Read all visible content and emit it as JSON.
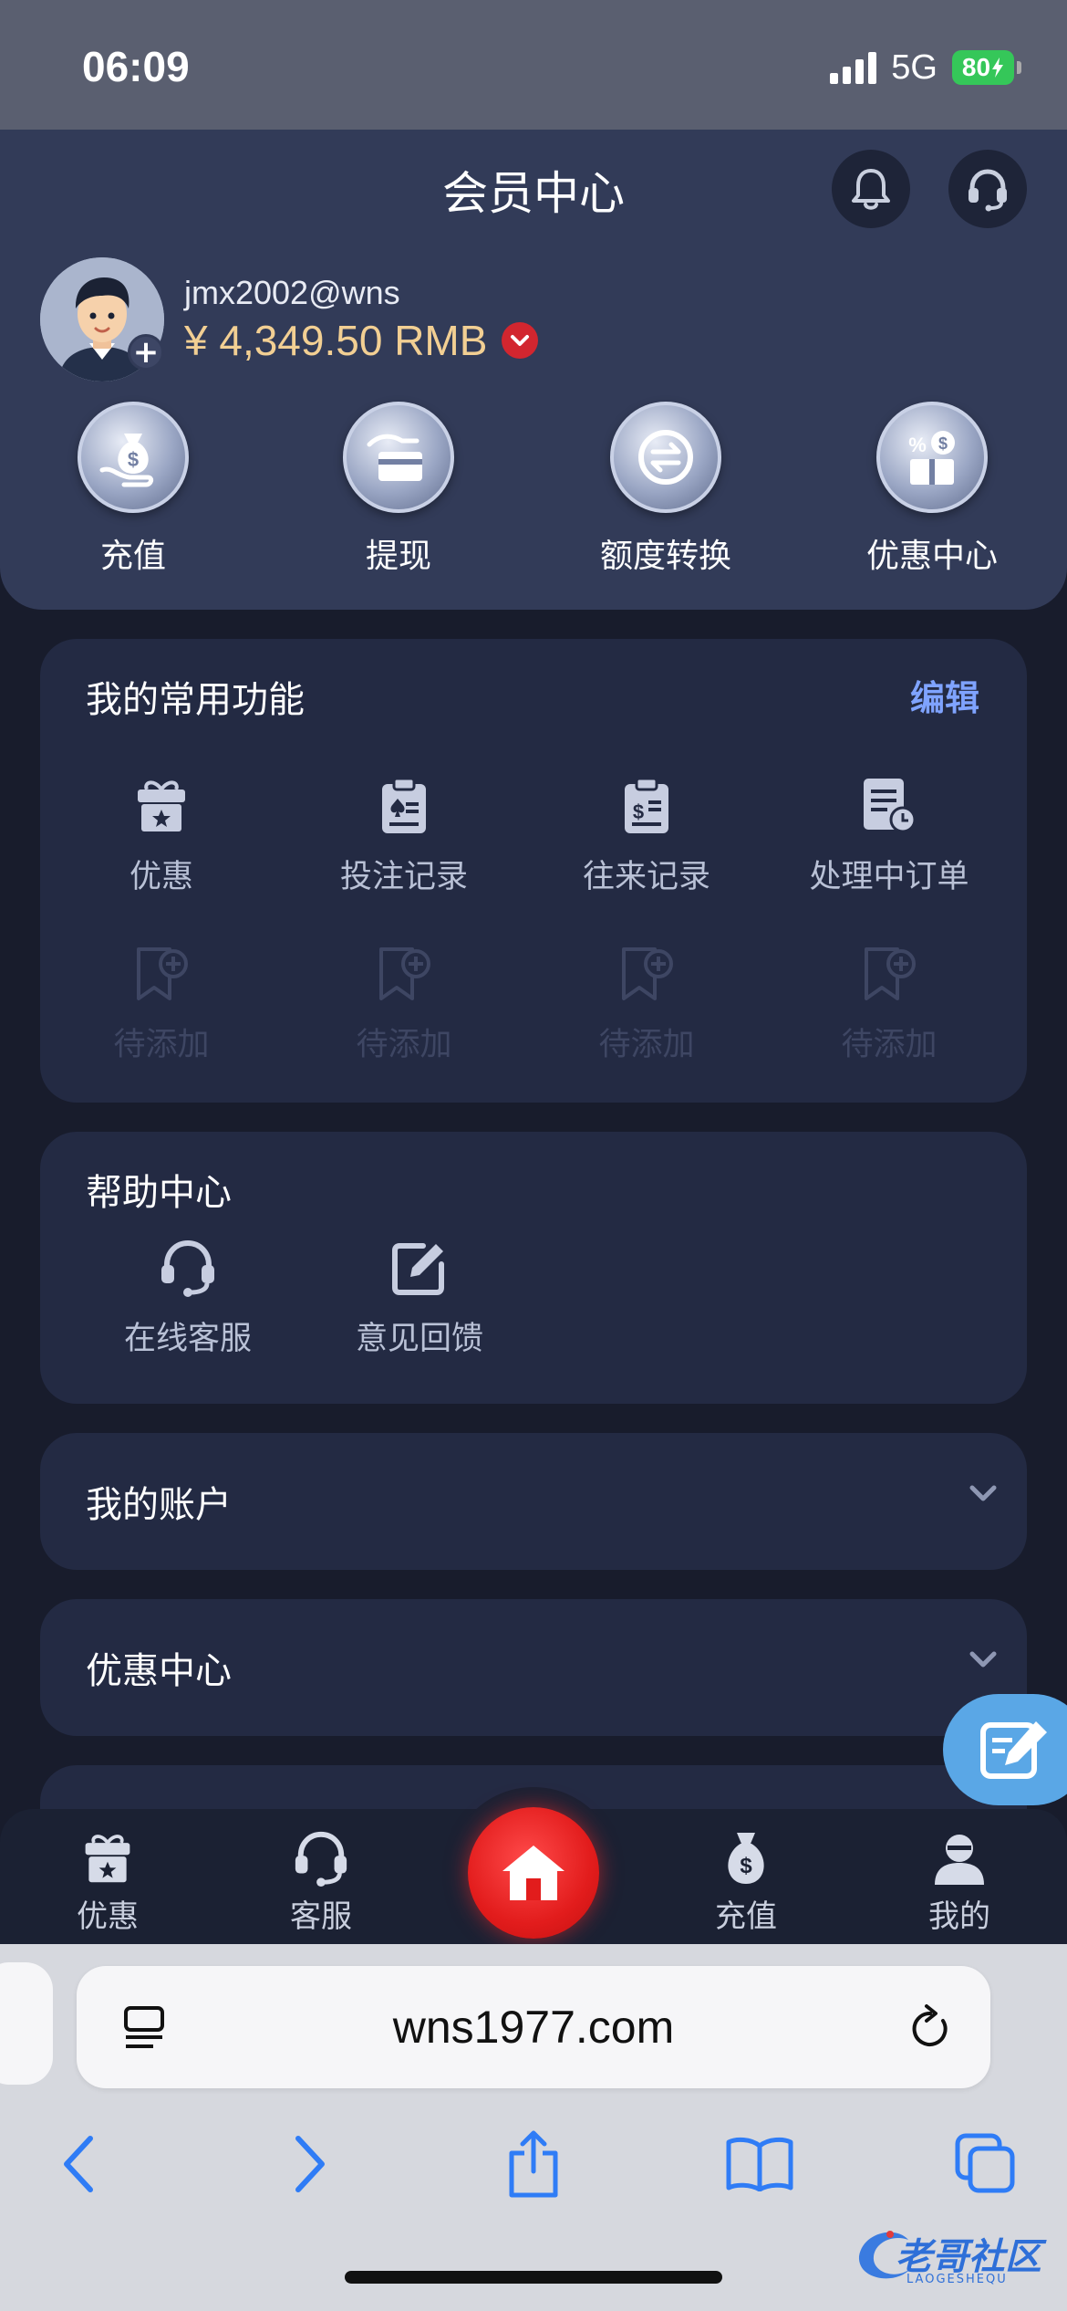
{
  "status_bar": {
    "time": "06:09",
    "network": "5G",
    "battery": "80"
  },
  "header": {
    "title": "会员中心",
    "username": "jmx2002@wns",
    "balance": "¥ 4,349.50 RMB",
    "quick_actions": [
      {
        "label": "充值",
        "icon": "money-bag-hand-icon"
      },
      {
        "label": "提现",
        "icon": "withdraw-card-icon"
      },
      {
        "label": "额度转换",
        "icon": "exchange-icon"
      },
      {
        "label": "优惠中心",
        "icon": "promo-center-icon"
      }
    ]
  },
  "frequent": {
    "title": "我的常用功能",
    "edit_label": "编辑",
    "items": [
      {
        "label": "优惠",
        "icon": "gift-icon"
      },
      {
        "label": "投注记录",
        "icon": "bet-record-icon"
      },
      {
        "label": "往来记录",
        "icon": "transaction-record-icon"
      },
      {
        "label": "处理中订单",
        "icon": "pending-order-icon"
      }
    ],
    "placeholders": [
      "待添加",
      "待添加",
      "待添加",
      "待添加"
    ]
  },
  "help": {
    "title": "帮助中心",
    "items": [
      {
        "label": "在线客服",
        "icon": "headset-icon"
      },
      {
        "label": "意见回馈",
        "icon": "feedback-edit-icon"
      }
    ]
  },
  "accordions": {
    "account": "我的账户",
    "promo": "优惠中心"
  },
  "bottom_nav": {
    "promo": "优惠",
    "service": "客服",
    "deposit": "充值",
    "mine": "我的"
  },
  "browser": {
    "url": "wns1977.com"
  },
  "watermark": {
    "text": "老哥社区",
    "sub": "LAOGESHEQU"
  },
  "colors": {
    "background": "#181c2c",
    "header": "#323b58",
    "card": "#232a43",
    "accent_link": "#7fa3ff",
    "balance": "#f2cf93",
    "home_button": "#e21c1c",
    "float_button": "#5aa7e6"
  }
}
